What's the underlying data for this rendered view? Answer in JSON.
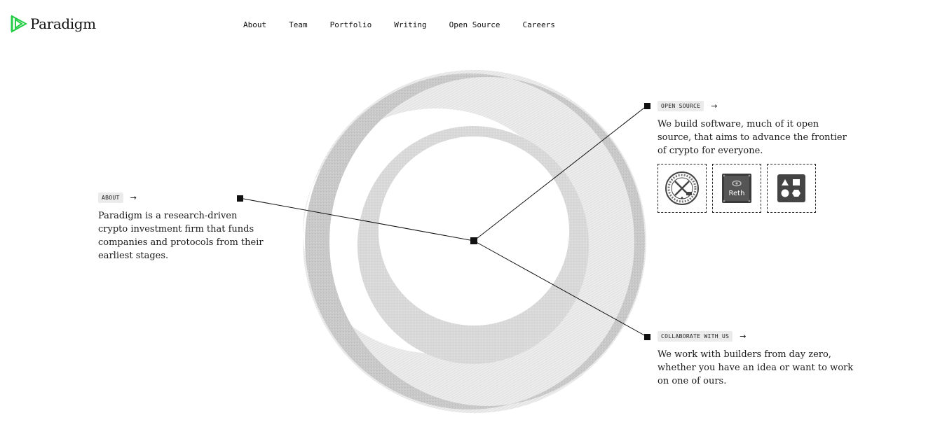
{
  "brand": {
    "name": "Paradigm",
    "color": "#22cc44"
  },
  "nav": {
    "items": [
      {
        "label": "About"
      },
      {
        "label": "Team"
      },
      {
        "label": "Portfolio"
      },
      {
        "label": "Writing"
      },
      {
        "label": "Open Source"
      },
      {
        "label": "Careers"
      }
    ]
  },
  "sections": {
    "about": {
      "tag": "ABOUT",
      "arrow": "→",
      "text": "Paradigm is a research-driven crypto investment firm that funds companies and protocols from their earliest stages."
    },
    "open_source": {
      "tag": "OPEN SOURCE",
      "arrow": "→",
      "text": "We build software, much of it open source, that aims to advance the frontier of crypto for everyone.",
      "projects": [
        {
          "icon": "foundry-icon"
        },
        {
          "icon": "reth-icon",
          "label": "Reth"
        },
        {
          "icon": "shapes-icon"
        }
      ]
    },
    "collaborate": {
      "tag": "COLLABORATE WITH US",
      "arrow": "→",
      "text": "We work with builders from day zero, whether you have an idea or want to work on one of ours."
    }
  }
}
